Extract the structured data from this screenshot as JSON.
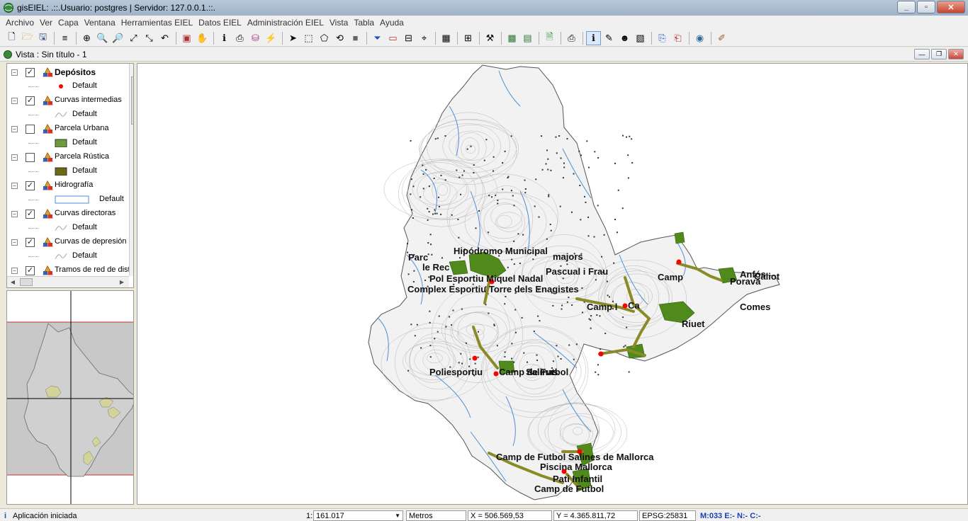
{
  "window": {
    "title": "gisEIEL: .::.Usuario: postgres | Servidor: 127.0.0.1.::."
  },
  "menu": [
    "Archivo",
    "Ver",
    "Capa",
    "Ventana",
    "Herramientas EIEL",
    "Datos EIEL",
    "Administración EIEL",
    "Vista",
    "Tabla",
    "Ayuda"
  ],
  "view": {
    "title": "Vista : Sin título - 1"
  },
  "toc": {
    "layers": [
      {
        "label": "Depósitos",
        "checked": true,
        "bold": true,
        "legend": "Default",
        "symbol": "red-dot"
      },
      {
        "label": "Curvas intermedias",
        "checked": true,
        "legend": "Default",
        "symbol": "curve"
      },
      {
        "label": "Parcela Urbana",
        "checked": false,
        "legend": "Default",
        "symbol": "green-fill"
      },
      {
        "label": "Parcela Rústica",
        "checked": false,
        "legend": "Default",
        "symbol": "olive-fill"
      },
      {
        "label": "Hidrografía",
        "checked": true,
        "legend": "Default",
        "symbol": "blue-outline"
      },
      {
        "label": "Curvas directoras",
        "checked": true,
        "legend": "Default",
        "symbol": "curve"
      },
      {
        "label": "Curvas de depresión",
        "checked": true,
        "legend": "Default",
        "symbol": "curve"
      },
      {
        "label": "Tramos de red de distribución",
        "checked": true,
        "legend": "",
        "symbol": ""
      }
    ]
  },
  "map": {
    "labels": [
      "Hipódromo Municipal",
      "Parc",
      "le Rec",
      "majors",
      "Pascual i Frau",
      "Pol Esportiu Miquel Nadal",
      "Complex Esportiu Torre dels Enagistes",
      "Camp l",
      "Ca",
      "Comes",
      "Riuet",
      "Camp",
      "Anfós",
      "Caliot",
      "Porava",
      "Poliesportiu",
      "Camp de Futbol",
      "Salinas",
      "Camp de Futbol Salines de Mallorca",
      "Piscina Mallorca",
      "Pati Infantil",
      "Camp de Futbol"
    ]
  },
  "status": {
    "message": "Aplicación iniciada",
    "scale_prefix": "1:",
    "scale": "161.017",
    "units": "Metros",
    "x": "X = 506.569,53",
    "y": "Y = 4.365.811,72",
    "epsg": "EPSG:25831",
    "memory": "M:033 E:-  N:-  C:-"
  },
  "colors": {
    "urban": "#4f8a1b",
    "network": "#8a8a26",
    "water": "#4a8fd6",
    "deposit": "#ff0000",
    "locator_bg": "#c8c8c8",
    "locator_urban": "#d4d49a"
  },
  "icons": {
    "app": "globe-icon",
    "info": "info-icon"
  }
}
